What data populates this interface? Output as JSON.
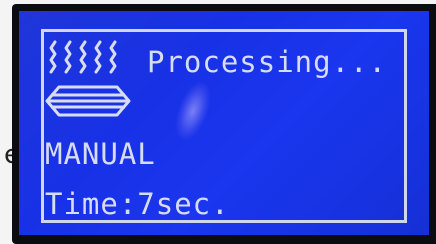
{
  "display": {
    "status_text": "Processing...",
    "mode_text": "MANUAL",
    "time_text": "Time:7sec.",
    "bezel_edge_text": "e"
  },
  "icons": {
    "heat": "heat-waves-icon",
    "plate": "heating-plate-icon"
  },
  "colors": {
    "lcd_background": "#1a36ee",
    "lcd_text": "#d7dcf2",
    "bezel": "#0b0b12"
  }
}
